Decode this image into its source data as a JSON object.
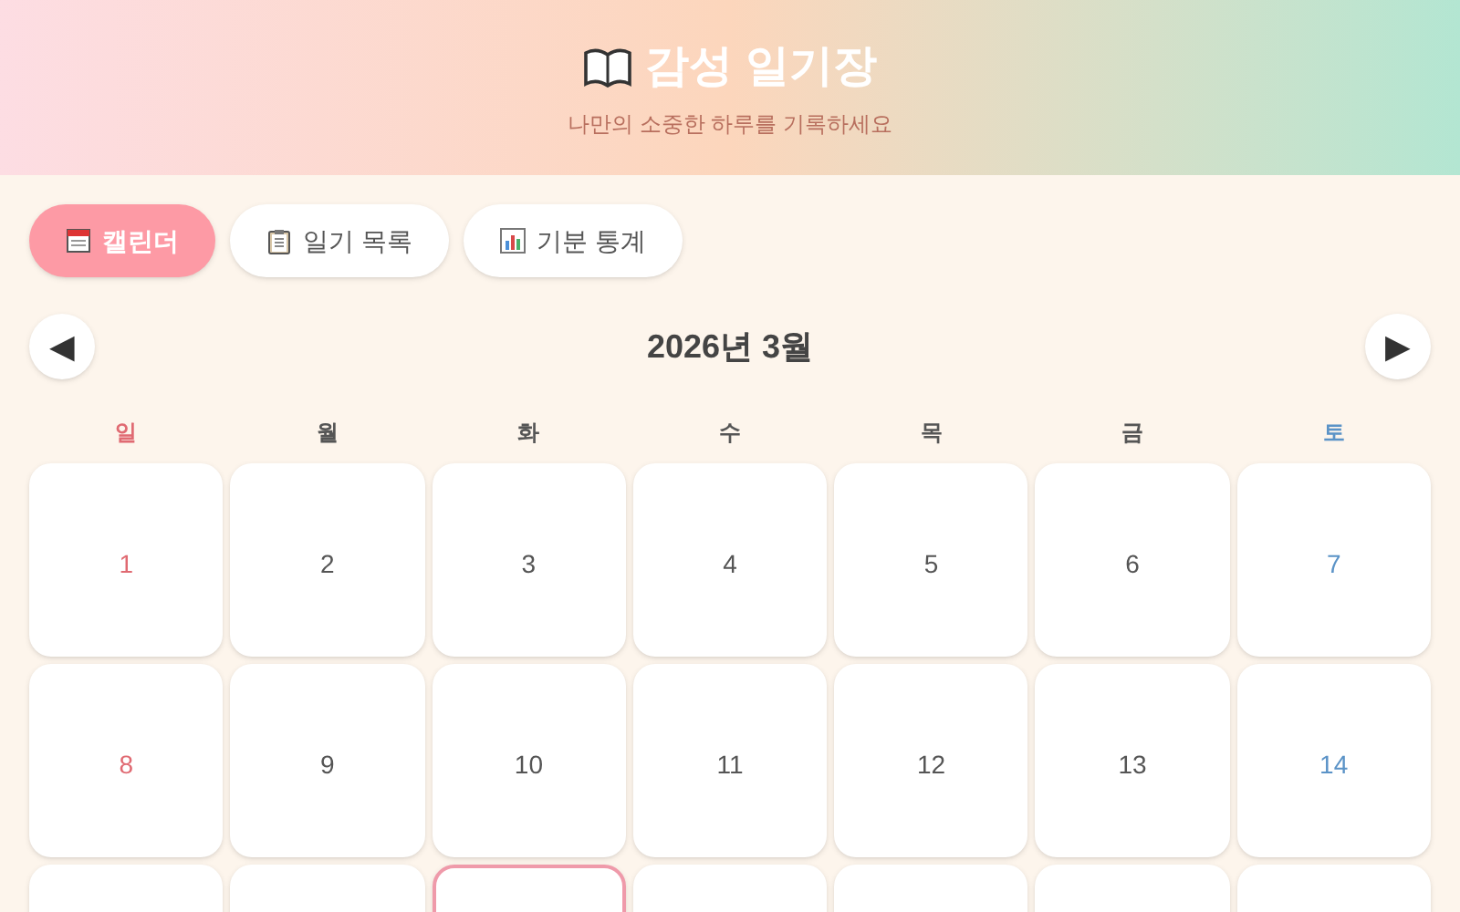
{
  "header": {
    "title": "감성 일기장",
    "subtitle": "나만의 소중한 하루를 기록하세요"
  },
  "tabs": [
    {
      "label": "캘린더",
      "kind": "calendar",
      "selected": true
    },
    {
      "label": "일기 목록",
      "kind": "list",
      "selected": false
    },
    {
      "label": "기분 통계",
      "kind": "stats",
      "selected": false
    }
  ],
  "calendar": {
    "prev": "◀",
    "month": "2026년 3월",
    "next": "▶",
    "weekdays": [
      "일",
      "월",
      "화",
      "수",
      "목",
      "금",
      "토"
    ],
    "weeks": [
      [
        {
          "day": "1",
          "today": false
        },
        {
          "day": "2",
          "today": false
        },
        {
          "day": "3",
          "today": false
        },
        {
          "day": "4",
          "today": false
        },
        {
          "day": "5",
          "today": false
        },
        {
          "day": "6",
          "today": false
        },
        {
          "day": "7",
          "today": false
        }
      ],
      [
        {
          "day": "8",
          "today": false
        },
        {
          "day": "9",
          "today": false
        },
        {
          "day": "10",
          "today": false
        },
        {
          "day": "11",
          "today": false
        },
        {
          "day": "12",
          "today": false
        },
        {
          "day": "13",
          "today": false
        },
        {
          "day": "14",
          "today": false
        }
      ],
      [
        {
          "today": false
        },
        {
          "today": false
        },
        {
          "today": true
        },
        {
          "today": false
        },
        {
          "today": false
        },
        {
          "today": false
        },
        {
          "today": false
        }
      ]
    ]
  }
}
